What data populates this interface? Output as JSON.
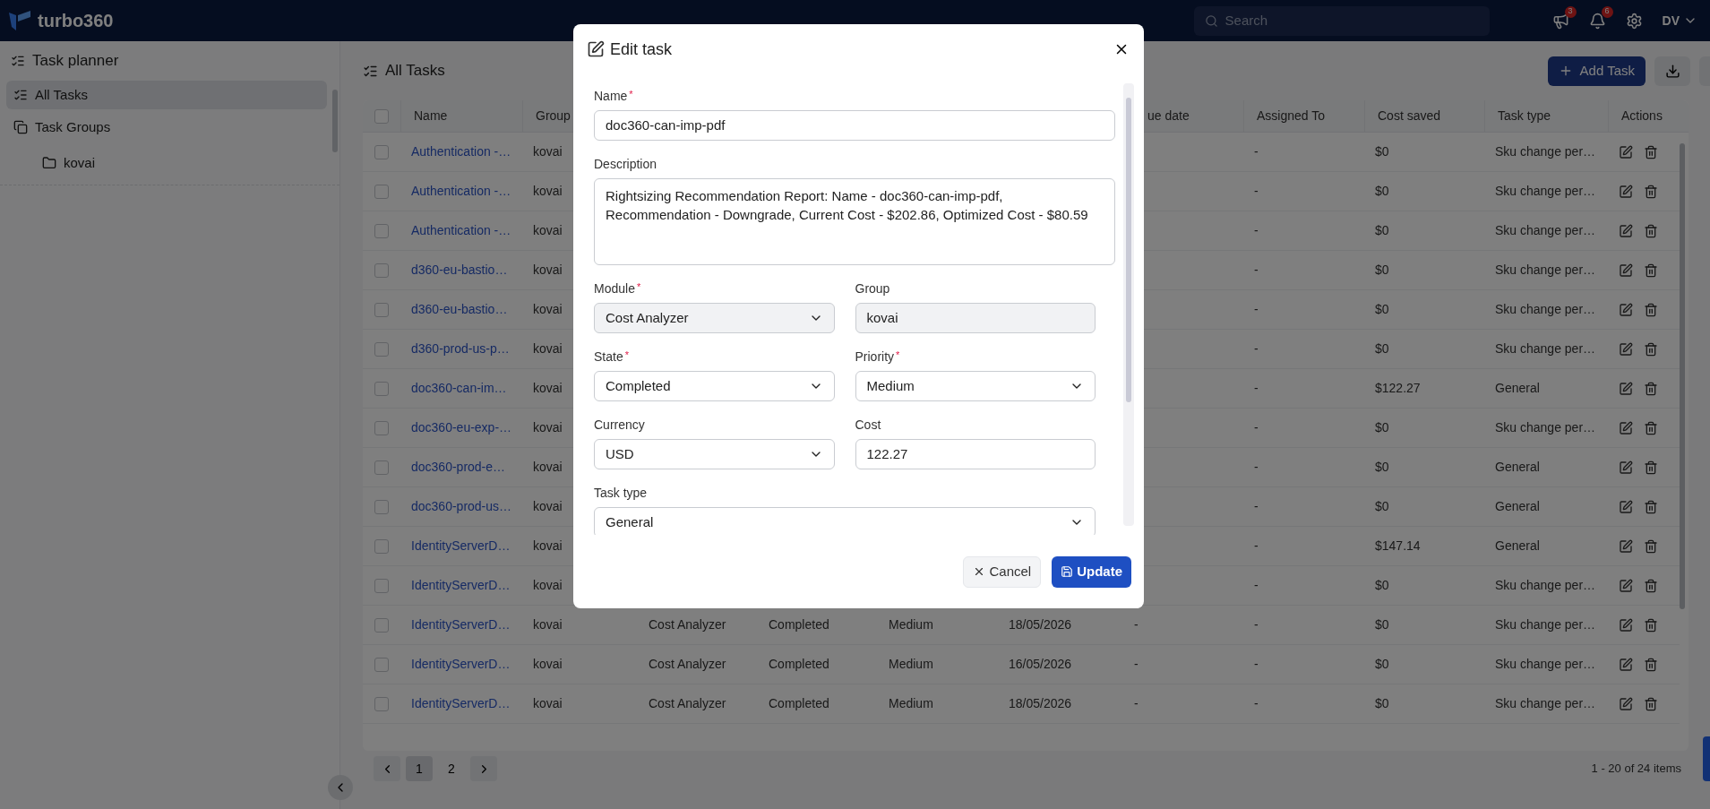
{
  "topbar": {
    "logo": "turbo360",
    "search": {
      "placeholder": "Search"
    },
    "notifications": [
      {
        "kind": "megaphone",
        "badge": "3"
      },
      {
        "kind": "bell",
        "badge": "6"
      }
    ],
    "user": {
      "initials": "DV"
    }
  },
  "sidebar": {
    "title": "Task planner",
    "items": [
      {
        "label": "All Tasks",
        "kind": "list",
        "selected": true
      },
      {
        "label": "Task Groups",
        "kind": "groups",
        "selected": false,
        "children": [
          {
            "label": "kovai",
            "kind": "folder",
            "selected": false
          }
        ]
      }
    ]
  },
  "main": {
    "title": "All Tasks",
    "add_button": "Add Task"
  },
  "table": {
    "all_checked": false,
    "columns": [
      "Name",
      "Group",
      null,
      null,
      null,
      null,
      "ue date",
      "Assigned To",
      "Cost saved",
      "Task type",
      "Actions"
    ],
    "rows": [
      {
        "checked": false,
        "cells": [
          "Authentication -…",
          "kovai",
          null,
          null,
          null,
          null,
          null,
          "-",
          "$0",
          "Sku change per…"
        ]
      },
      {
        "checked": false,
        "cells": [
          "Authentication -…",
          "kovai",
          null,
          null,
          null,
          null,
          null,
          "-",
          "$0",
          "Sku change per…"
        ]
      },
      {
        "checked": false,
        "cells": [
          "Authentication -…",
          "kovai",
          null,
          null,
          null,
          null,
          null,
          "-",
          "$0",
          "Sku change per…"
        ]
      },
      {
        "checked": false,
        "cells": [
          "d360-eu-bastio…",
          "kovai",
          null,
          null,
          null,
          null,
          null,
          "-",
          "$0",
          "Sku change per…"
        ]
      },
      {
        "checked": false,
        "cells": [
          "d360-eu-bastio…",
          "kovai",
          null,
          null,
          null,
          null,
          null,
          "-",
          "$0",
          "Sku change per…"
        ]
      },
      {
        "checked": false,
        "cells": [
          "d360-prod-us-p…",
          "kovai",
          null,
          null,
          null,
          null,
          null,
          "-",
          "$0",
          "Sku change per…"
        ]
      },
      {
        "checked": false,
        "cells": [
          "doc360-can-im…",
          "kovai",
          null,
          null,
          null,
          null,
          null,
          "-",
          "$122.27",
          "General"
        ]
      },
      {
        "checked": false,
        "cells": [
          "doc360-eu-exp-…",
          "kovai",
          null,
          null,
          null,
          null,
          null,
          "-",
          "$0",
          "Sku change per…"
        ]
      },
      {
        "checked": false,
        "cells": [
          "doc360-prod-e…",
          "kovai",
          null,
          null,
          null,
          null,
          null,
          "-",
          "$0",
          "General"
        ]
      },
      {
        "checked": false,
        "cells": [
          "doc360-prod-us…",
          "kovai",
          null,
          null,
          null,
          null,
          null,
          "-",
          "$0",
          "General"
        ]
      },
      {
        "checked": false,
        "cells": [
          "IdentityServerD…",
          "kovai",
          null,
          null,
          null,
          null,
          null,
          "-",
          "$147.14",
          "General"
        ]
      },
      {
        "checked": false,
        "cells": [
          "IdentityServerD…",
          "kovai",
          null,
          null,
          null,
          null,
          null,
          "-",
          "$0",
          "Sku change per…"
        ]
      },
      {
        "checked": false,
        "cells": [
          "IdentityServerD…",
          "kovai",
          "Cost Analyzer",
          "Completed",
          "Medium",
          "18/05/2026",
          "-",
          "-",
          "$0",
          "Sku change per…"
        ]
      },
      {
        "checked": false,
        "cells": [
          "IdentityServerD…",
          "kovai",
          "Cost Analyzer",
          "Completed",
          "Medium",
          "16/05/2026",
          "-",
          "-",
          "$0",
          "Sku change per…"
        ]
      },
      {
        "checked": false,
        "cells": [
          "IdentityServerD…",
          "kovai",
          "Cost Analyzer",
          "Completed",
          "Medium",
          "18/05/2026",
          "-",
          "-",
          "$0",
          "Sku change per…"
        ]
      }
    ]
  },
  "pagination": {
    "pages": [
      {
        "label": "1",
        "selected": true
      },
      {
        "label": "2",
        "selected": false
      }
    ],
    "summary": "1 - 20 of 24 items"
  },
  "modal": {
    "title": "Edit task",
    "fields": [
      {
        "label": "Name",
        "kind": "text",
        "required_mark": "*",
        "disabled": false,
        "wide": true,
        "value": "doc360-can-imp-pdf"
      },
      {
        "label": "Description",
        "kind": "textarea",
        "disabled": false,
        "wide": true,
        "value": "Rightsizing Recommendation Report:  Name - doc360-can-imp-pdf, Recommendation - Downgrade, Current Cost - $202.86, Optimized Cost - $80.59"
      },
      {
        "label": "Module",
        "kind": "select",
        "required_mark": "*",
        "disabled": true,
        "wide": false,
        "value": "Cost Analyzer"
      },
      {
        "label": "Group",
        "kind": "text",
        "disabled": true,
        "wide": false,
        "value": "kovai"
      },
      {
        "label": "State",
        "kind": "select",
        "required_mark": "*",
        "disabled": false,
        "wide": false,
        "value": "Completed"
      },
      {
        "label": "Priority",
        "kind": "select",
        "required_mark": "*",
        "disabled": false,
        "wide": false,
        "value": "Medium"
      },
      {
        "label": "Currency",
        "kind": "select",
        "disabled": false,
        "wide": false,
        "value": "USD"
      },
      {
        "label": "Cost",
        "kind": "text",
        "disabled": false,
        "wide": false,
        "value": "122.27"
      },
      {
        "label": "Task type",
        "kind": "select",
        "disabled": false,
        "wide": true,
        "value": "General"
      }
    ],
    "cancel": "Cancel",
    "update": "Update"
  }
}
